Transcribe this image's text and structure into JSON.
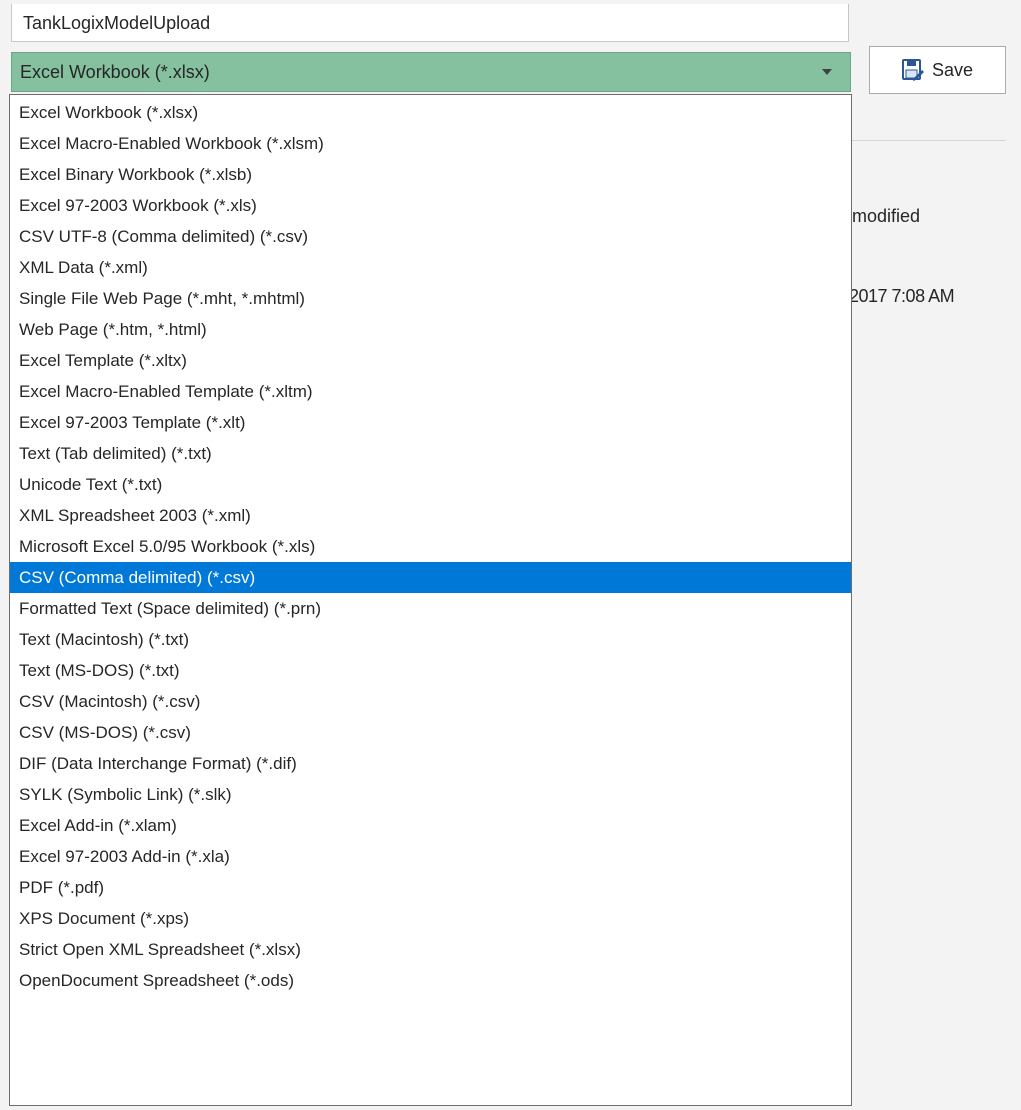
{
  "filename": {
    "value": "TankLogixModelUpload"
  },
  "file_type": {
    "selected": "Excel Workbook (*.xlsx)",
    "options": [
      "Excel Workbook (*.xlsx)",
      "Excel Macro-Enabled Workbook (*.xlsm)",
      "Excel Binary Workbook (*.xlsb)",
      "Excel 97-2003 Workbook (*.xls)",
      "CSV UTF-8 (Comma delimited) (*.csv)",
      "XML Data (*.xml)",
      "Single File Web Page (*.mht, *.mhtml)",
      "Web Page (*.htm, *.html)",
      "Excel Template (*.xltx)",
      "Excel Macro-Enabled Template (*.xltm)",
      "Excel 97-2003 Template (*.xlt)",
      "Text (Tab delimited) (*.txt)",
      "Unicode Text (*.txt)",
      "XML Spreadsheet 2003 (*.xml)",
      "Microsoft Excel 5.0/95 Workbook (*.xls)",
      "CSV (Comma delimited) (*.csv)",
      "Formatted Text (Space delimited) (*.prn)",
      "Text (Macintosh) (*.txt)",
      "Text (MS-DOS) (*.txt)",
      "CSV (Macintosh) (*.csv)",
      "CSV (MS-DOS) (*.csv)",
      "DIF (Data Interchange Format) (*.dif)",
      "SYLK (Symbolic Link) (*.slk)",
      "Excel Add-in (*.xlam)",
      "Excel 97-2003 Add-in (*.xla)",
      "PDF (*.pdf)",
      "XPS Document (*.xps)",
      "Strict Open XML Spreadsheet (*.xlsx)",
      "OpenDocument Spreadsheet (*.ods)"
    ],
    "highlighted_option": "CSV (Comma delimited) (*.csv)",
    "icon": "chevron-down-icon"
  },
  "save_button": {
    "label": "Save",
    "icon": "save-as-icon"
  },
  "file_list_partial": {
    "column_header": "modified",
    "date_value": "2017 7:08 AM"
  },
  "colors": {
    "select_background": "#86c19f",
    "highlight": "#0078d7",
    "save_icon_blue": "#2b579a"
  }
}
